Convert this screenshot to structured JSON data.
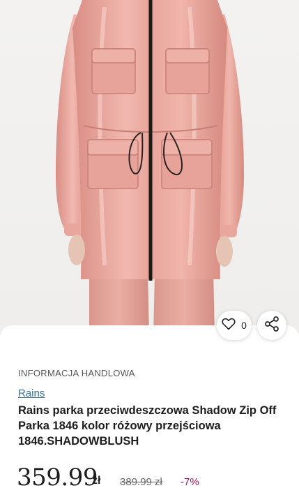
{
  "product": {
    "like_count": "0",
    "info_label": "INFORMACJA HANDLOWA",
    "brand": "Rains",
    "title": "Rains parka przeciwdeszczowa Shadow Zip Off Parka 1846 kolor różowy przejściowa 1846.SHADOWBLUSH",
    "price": "359.99",
    "currency": "zł",
    "old_price": "389.99 zł",
    "discount": "-7%"
  },
  "icons": {
    "like": "heart-icon",
    "share": "share-icon"
  },
  "colors": {
    "jacket": "#e5a39a",
    "brand_link": "#3a6f8f",
    "discount": "#a3175d"
  }
}
